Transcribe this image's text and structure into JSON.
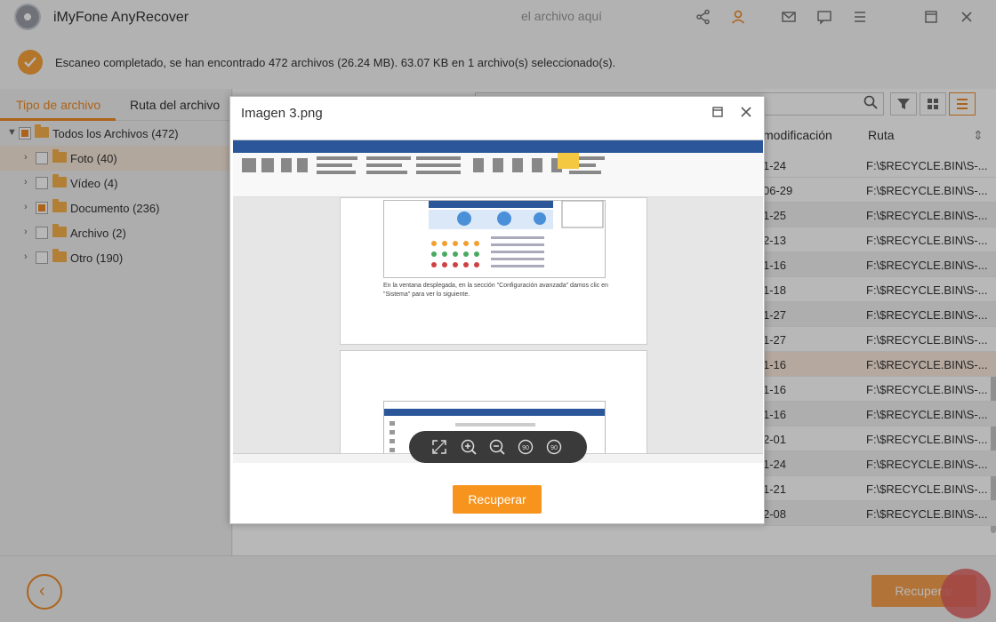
{
  "app": {
    "title": "iMyFone AnyRecover"
  },
  "status": {
    "message": "Escaneo completado, se han encontrado 472 archivos (26.24 MB). 63.07 KB en 1 archivo(s) seleccionado(s)."
  },
  "tabs": {
    "file_type": "Tipo de archivo",
    "file_path": "Ruta del archivo"
  },
  "tree": {
    "root": "Todos los Archivos (472)",
    "items": [
      {
        "label": "Foto (40)"
      },
      {
        "label": "Vídeo (4)"
      },
      {
        "label": "Documento (236)"
      },
      {
        "label": "Archivo (2)"
      },
      {
        "label": "Otro (190)"
      }
    ]
  },
  "search": {
    "placeholder": "el archivo aquí"
  },
  "columns": {
    "modified": "modificación",
    "path": "Ruta"
  },
  "rows": [
    {
      "date": "1-24",
      "path": "F:\\$RECYCLE.BIN\\S-..."
    },
    {
      "date": "06-29",
      "path": "F:\\$RECYCLE.BIN\\S-..."
    },
    {
      "date": "1-25",
      "path": "F:\\$RECYCLE.BIN\\S-..."
    },
    {
      "date": "2-13",
      "path": "F:\\$RECYCLE.BIN\\S-..."
    },
    {
      "date": "1-16",
      "path": "F:\\$RECYCLE.BIN\\S-..."
    },
    {
      "date": "1-18",
      "path": "F:\\$RECYCLE.BIN\\S-..."
    },
    {
      "date": "1-27",
      "path": "F:\\$RECYCLE.BIN\\S-..."
    },
    {
      "date": "1-27",
      "path": "F:\\$RECYCLE.BIN\\S-..."
    },
    {
      "date": "1-16",
      "path": "F:\\$RECYCLE.BIN\\S-..."
    },
    {
      "date": "1-16",
      "path": "F:\\$RECYCLE.BIN\\S-..."
    },
    {
      "date": "1-16",
      "path": "F:\\$RECYCLE.BIN\\S-..."
    },
    {
      "date": "2-01",
      "path": "F:\\$RECYCLE.BIN\\S-..."
    },
    {
      "date": "1-24",
      "path": "F:\\$RECYCLE.BIN\\S-..."
    },
    {
      "date": "1-21",
      "path": "F:\\$RECYCLE.BIN\\S-..."
    },
    {
      "date": "2-08",
      "path": "F:\\$RECYCLE.BIN\\S-..."
    }
  ],
  "bottom": {
    "recover_label": "Recuperar"
  },
  "dialog": {
    "title": "Imagen 3.png",
    "recover_label": "Recuperar",
    "doc_caption": "En la ventana desplegada, en la sección \"Configuración avanzada\" damos clic en \"Sistema\" para ver lo siguiente.",
    "zoom_rotate_left": "90",
    "zoom_rotate_right": "90"
  },
  "colors": {
    "accent": "#f08a24",
    "button": "#f7941d",
    "word_blue": "#2b579a"
  }
}
